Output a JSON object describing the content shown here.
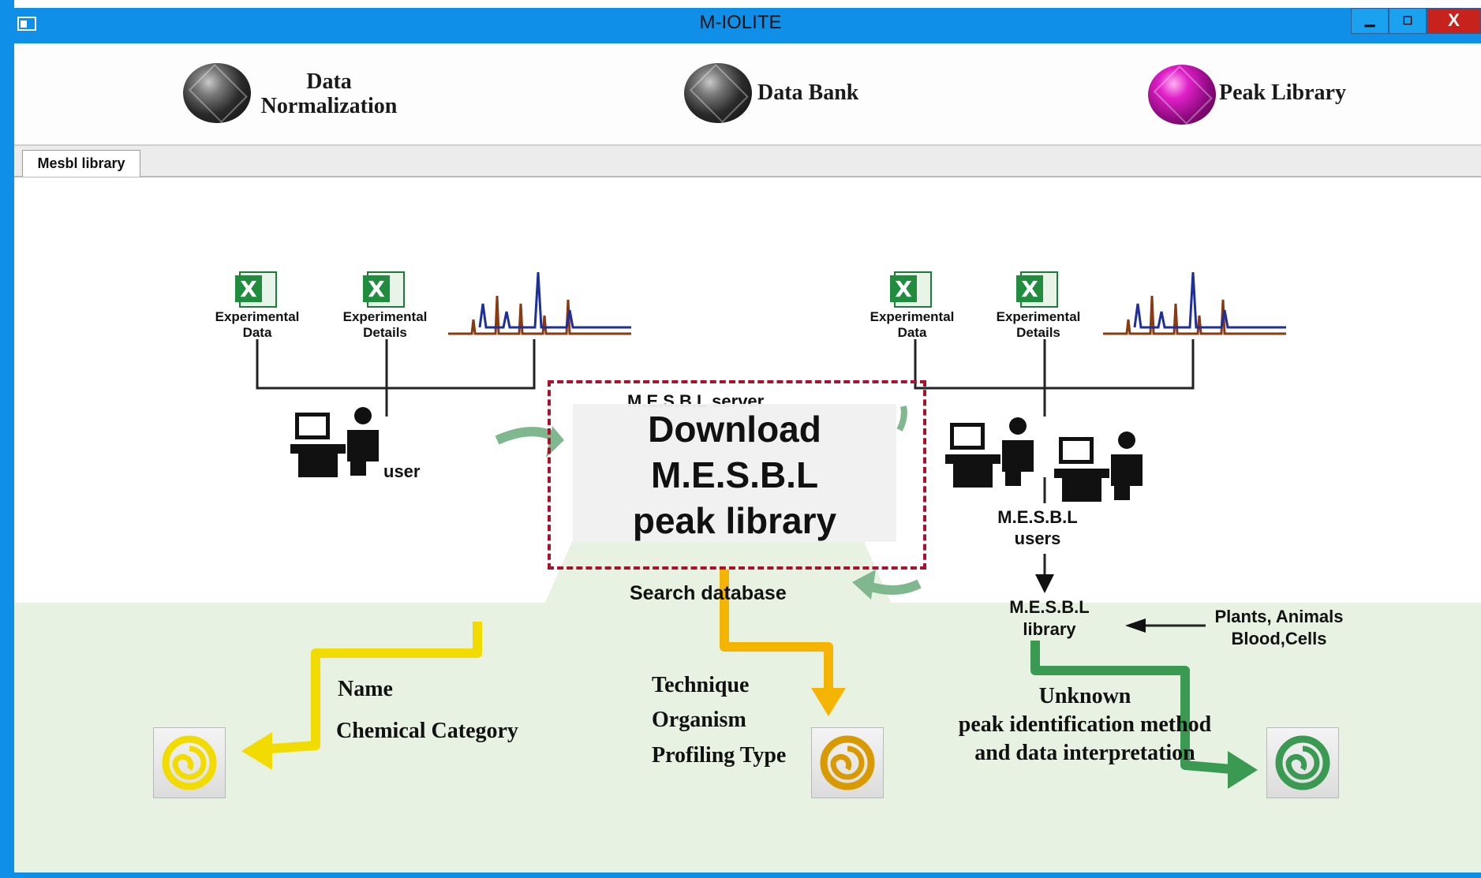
{
  "window": {
    "title": "M-IOLITE",
    "controls": {
      "minimize": "▁",
      "maximize": "☐",
      "close": "X"
    },
    "border_color": "#0f8fe8",
    "close_color": "#c7221c"
  },
  "ribbon": {
    "items": [
      {
        "label_line1": "Data",
        "label_line2": "Normalization",
        "icon": "gray-gem-icon"
      },
      {
        "label": "Data Bank",
        "icon": "gray-gem-icon"
      },
      {
        "label": "Peak Library",
        "icon": "magenta-gem-icon"
      }
    ]
  },
  "tabs": [
    {
      "label": "Mesbl library"
    }
  ],
  "diagram": {
    "left": {
      "file1": {
        "line1": "Experimental",
        "line2": "Data"
      },
      "file2": {
        "line1": "Experimental",
        "line2": "Details"
      },
      "user_label": "user"
    },
    "right": {
      "file1": {
        "line1": "Experimental",
        "line2": "Data"
      },
      "file2": {
        "line1": "Experimental",
        "line2": "Details"
      },
      "users_line1": "M.E.S.B.L",
      "users_line2": "users"
    },
    "server_label": "M.E.S.B.L server",
    "search_label": "Search database",
    "library_line1": "M.E.S.B.L",
    "library_line2": "library",
    "sources_line1": "Plants, Animals",
    "sources_line2": "Blood,Cells",
    "yellow_branch": {
      "item1": "Name",
      "item2": "Chemical Category",
      "color": "#f2dc00"
    },
    "orange_branch": {
      "item1": "Technique",
      "item2": "Organism",
      "item3": "Profiling Type",
      "color": "#f5b400"
    },
    "green_branch": {
      "line1": "Unknown",
      "line2": "peak identification method",
      "line3": "and data interpretation",
      "color": "#3a9a52"
    }
  },
  "callout": {
    "line1": "Download",
    "line2": "M.E.S.B.L",
    "line3": "peak library",
    "border_color": "#a8122a"
  }
}
